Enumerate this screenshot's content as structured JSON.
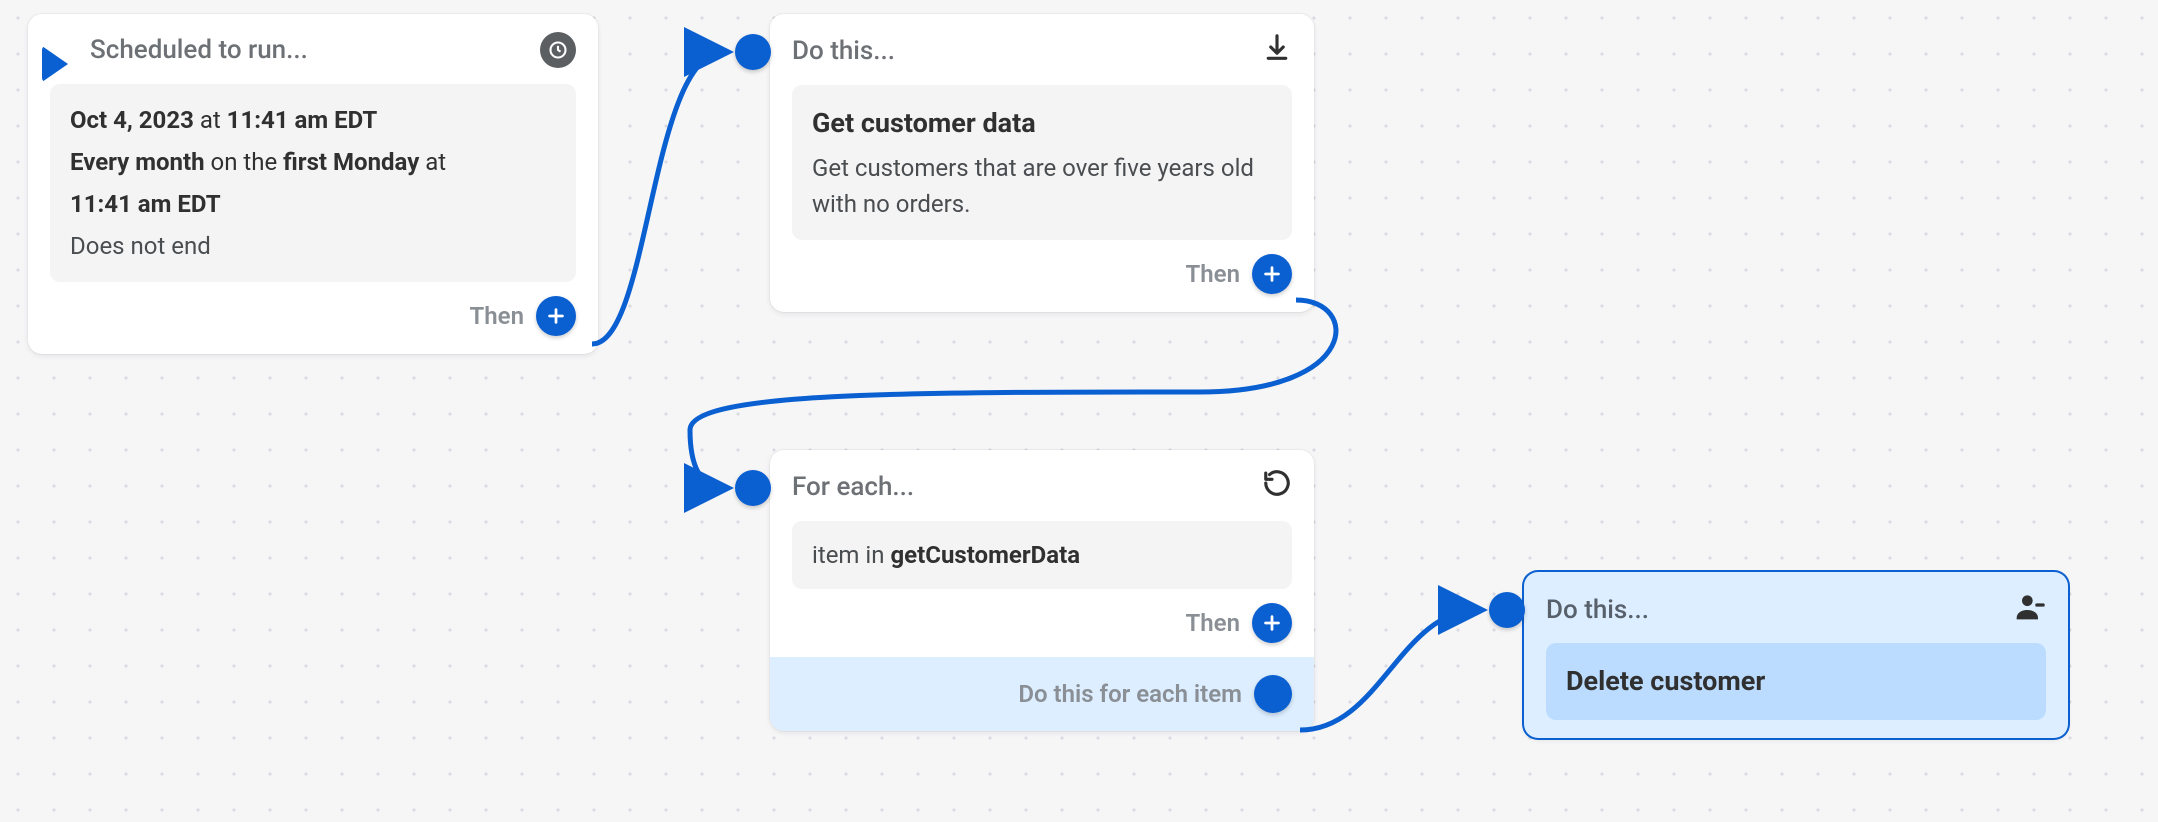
{
  "trigger": {
    "header": "Scheduled to run...",
    "date": "Oct 4, 2023",
    "at_word": "at",
    "time": "11:41 am EDT",
    "every": "Every month",
    "on_word": "on the",
    "day": "first Monday",
    "at_word2": "at",
    "time2": "11:41 am EDT",
    "does_not_end": "Does not end",
    "then_label": "Then"
  },
  "action1": {
    "header": "Do this...",
    "title": "Get customer data",
    "description": "Get customers that are over five years old with no orders.",
    "then_label": "Then"
  },
  "foreach": {
    "header": "For each...",
    "item_word": "item in",
    "source": "getCustomerData",
    "then_label": "Then",
    "sub_label": "Do this for each item"
  },
  "action2": {
    "header": "Do this...",
    "title": "Delete customer"
  }
}
